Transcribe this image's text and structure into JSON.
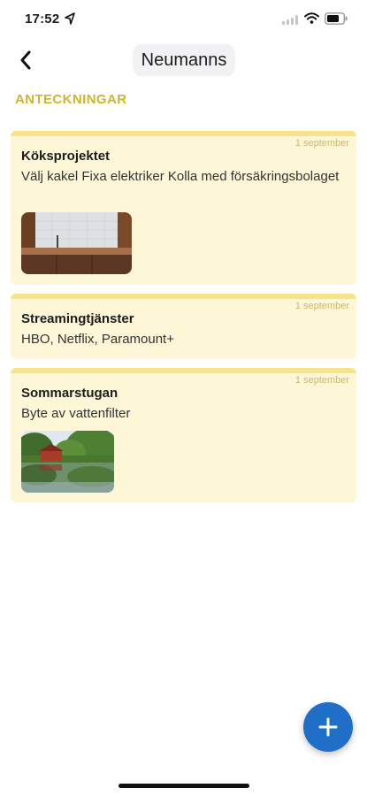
{
  "status_bar": {
    "time": "17:52",
    "icons": [
      "location-arrow-icon",
      "signal-icon",
      "wifi-icon",
      "battery-icon"
    ]
  },
  "header": {
    "back_icon": "chevron-left-icon",
    "title": "Neumanns"
  },
  "section": {
    "label": "ANTECKNINGAR"
  },
  "notes": [
    {
      "date": "1 september",
      "title": "Köksprojektet",
      "body": "Välj kakel Fixa elektriker Kolla med försäkringsbolaget",
      "image": "kitchen-photo"
    },
    {
      "date": "1 september",
      "title": "Streamingtjänster",
      "body": "HBO, Netflix, Paramount+"
    },
    {
      "date": "1 september",
      "title": "Sommarstugan",
      "body": "Byte av vattenfilter",
      "image": "lake-cottage-photo"
    }
  ],
  "fab": {
    "icon": "plus-icon"
  },
  "colors": {
    "accent": "#d1b42a",
    "card_background": "#fdf7d8",
    "card_stripe": "#f7e48a",
    "fab": "#1f6fc8"
  }
}
